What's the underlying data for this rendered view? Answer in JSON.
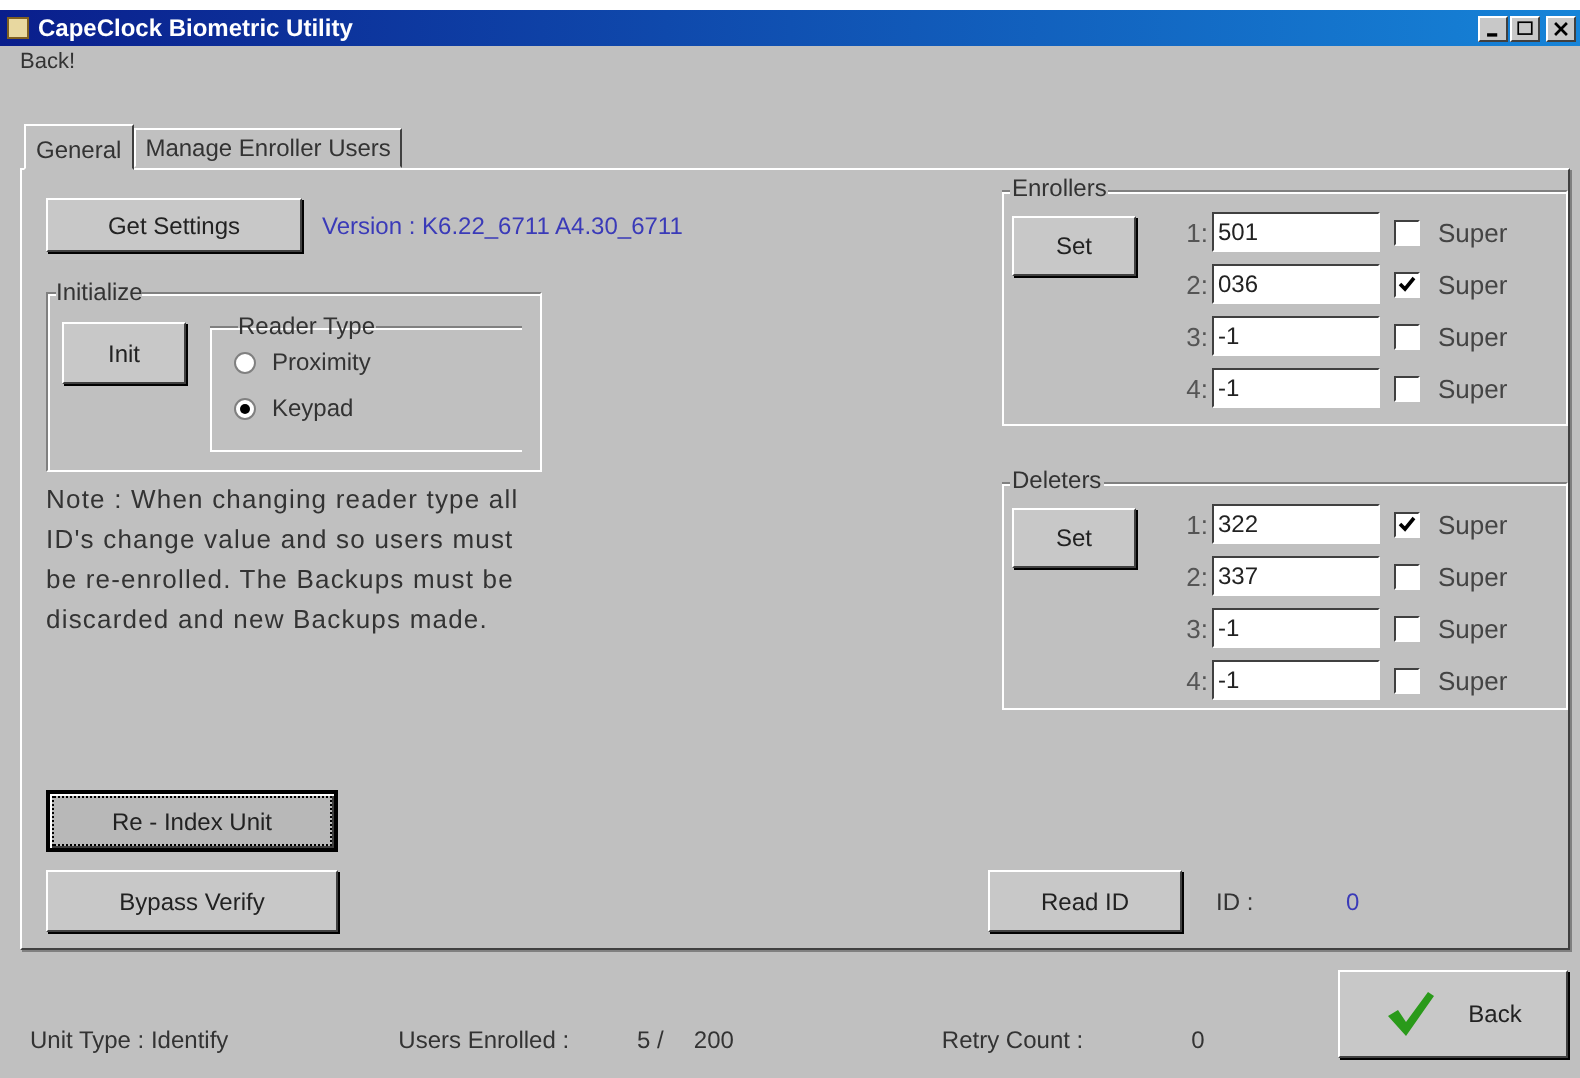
{
  "window": {
    "title": "CapeClock Biometric Utility"
  },
  "menu": [
    {
      "label": "Back!"
    }
  ],
  "tabs": [
    {
      "label": "General",
      "selected": true
    },
    {
      "label": "Manage Enroller Users",
      "selected": false
    }
  ],
  "settings": {
    "button": "Get Settings",
    "version": "Version : K6.22_6711 A4.30_6711"
  },
  "initialize": {
    "title": "Initialize",
    "button": "Init",
    "reader_type": {
      "title": "Reader Type",
      "options": [
        {
          "label": "Proximity",
          "selected": false
        },
        {
          "label": "Keypad",
          "selected": true
        }
      ]
    }
  },
  "note": "Note : When changing reader type all ID's change value and so users must be re-enrolled.  The Backups must be discarded and new Backups made.",
  "groups": [
    {
      "title": "Enrollers",
      "button": "Set",
      "rows": [
        {
          "index": "1:",
          "value": "501",
          "checked": false,
          "label": "Super"
        },
        {
          "index": "2:",
          "value": "036",
          "checked": true,
          "label": "Super"
        },
        {
          "index": "3:",
          "value": "-1",
          "checked": false,
          "label": "Super"
        },
        {
          "index": "4:",
          "value": "-1",
          "checked": false,
          "label": "Super"
        }
      ]
    },
    {
      "title": "Deleters",
      "button": "Set",
      "rows": [
        {
          "index": "1:",
          "value": "322",
          "checked": true,
          "label": "Super"
        },
        {
          "index": "2:",
          "value": "337",
          "checked": false,
          "label": "Super"
        },
        {
          "index": "3:",
          "value": "-1",
          "checked": false,
          "label": "Super"
        },
        {
          "index": "4:",
          "value": "-1",
          "checked": false,
          "label": "Super"
        }
      ]
    }
  ],
  "actions": [
    {
      "label": "Re - Index Unit",
      "focused": true
    },
    {
      "label": "Bypass Verify",
      "focused": false
    }
  ],
  "read_id": {
    "button": "Read ID",
    "label": "ID :",
    "value": "0"
  },
  "status_bar": {
    "unit_type": "Unit Type : Identify",
    "users_label": "Users Enrolled :",
    "users_count": "5 /",
    "users_max": "200",
    "retry_label": "Retry Count :",
    "retry_value": "0",
    "back_button": "Back"
  }
}
